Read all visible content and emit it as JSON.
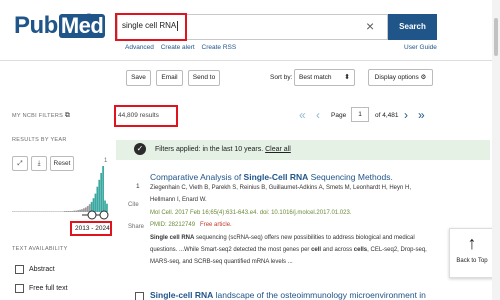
{
  "header": {
    "logo_pub": "Pub",
    "logo_med": "Med",
    "logo_reg": "®",
    "search_value": "single cell RNA",
    "clear_icon": "×",
    "search_button": "Search",
    "links": [
      "Advanced",
      "Create alert",
      "Create RSS"
    ],
    "user_guide": "User Guide"
  },
  "toolbar": {
    "save": "Save",
    "email": "Email",
    "send_to": "Send to",
    "sort_by_label": "Sort by:",
    "sort_value": "Best match",
    "display_options": "Display options"
  },
  "sidebar": {
    "my_filters": "MY NCBI FILTERS",
    "results_by_year": "RESULTS BY YEAR",
    "histogram_max_label": "1",
    "reset": "Reset",
    "year_range": "2013 - 2024",
    "text_availability": "TEXT AVAILABILITY",
    "checkboxes": [
      "Abstract",
      "Free full text"
    ]
  },
  "results": {
    "count": "44,809 results",
    "page_label": "Page",
    "page_value": "1",
    "of_pages": "of 4,481",
    "filters_applied": "Filters applied: in the last 10 years.",
    "clear_all": "Clear all"
  },
  "articles": [
    {
      "number": "1",
      "title_prefix": "Comparative Analysis of ",
      "title_bold": "Single-Cell RNA",
      "title_suffix": " Sequencing Methods.",
      "authors": "Ziegenhain C, Vieth B, Parekh S, Reinius B, Guillaumet-Adkins A, Smets M, Leonhardt H, Heyn H,",
      "authors2": "Hellmann I, Enard W.",
      "citation": "Mol Cell. 2017 Feb 16;65(4):631-643.e4. doi: 10.1016/j.molcel.2017.01.023.",
      "pmid": "PMID: 28212749",
      "free": "Free article.",
      "snippet_bold1": "Single cell RNA",
      "snippet1": " sequencing (scRNA-seq) offers new possibilities to address biological and medical",
      "snippet2_a": "questions. ...While Smart-seq2 detected the most genes per ",
      "snippet2_b": "cell",
      "snippet2_c": " and across ",
      "snippet2_d": "cells",
      "snippet2_e": ", CEL-seq2, Drop-seq,",
      "snippet3": "MARS-seq, and SCRB-seq quantified mRNA levels ..."
    },
    {
      "title_bold": "Single-cell RNA",
      "title_suffix": " landscape of the osteoimmunology microenvironment in"
    }
  ],
  "article_actions": [
    "Cite",
    "Share"
  ],
  "back_to_top": "Back to Top",
  "colors": {
    "brand": "#20558a",
    "accent_red": "#e0141e",
    "filter_bg": "#e5f1e5",
    "histogram": "#3aa8a0"
  },
  "histogram_values": [
    0.01,
    0.01,
    0.01,
    0.01,
    0.01,
    0.01,
    0.01,
    0.01,
    0.01,
    0.01,
    0.01,
    0.01,
    0.01,
    0.01,
    0.01,
    0.01,
    0.01,
    0.01,
    0.01,
    0.01,
    0.01,
    0.01,
    0.01,
    0.01,
    0.01,
    0.01,
    0.01,
    0.02,
    0.02,
    0.02,
    0.02,
    0.02,
    0.03,
    0.03,
    0.04,
    0.05,
    0.06,
    0.08,
    0.1,
    0.13,
    0.17,
    0.22,
    0.3,
    0.4,
    0.55,
    0.7,
    0.85,
    1.0,
    0.25,
    0.18
  ]
}
